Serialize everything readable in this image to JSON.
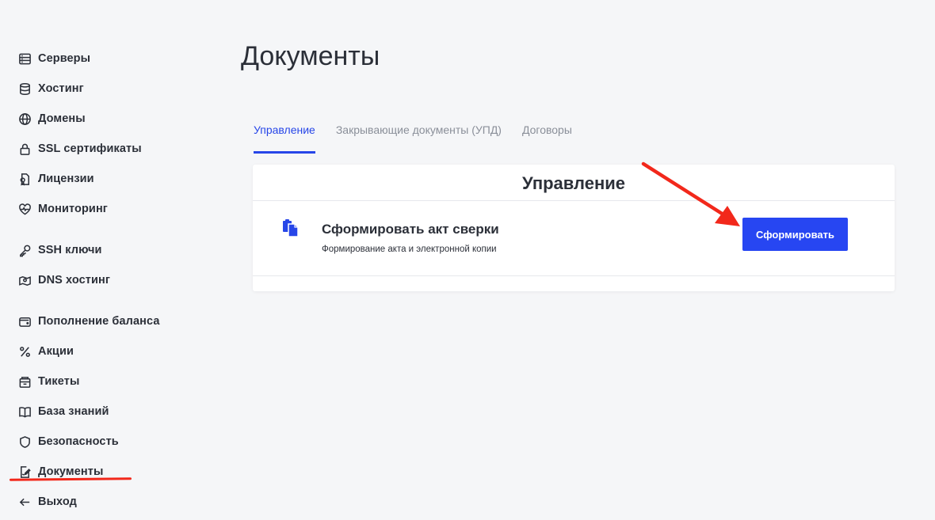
{
  "sidebar": {
    "items": [
      {
        "label": "Серверы",
        "icon": "server-icon"
      },
      {
        "label": "Хостинг",
        "icon": "database-icon"
      },
      {
        "label": "Домены",
        "icon": "globe-icon"
      },
      {
        "label": "SSL сертификаты",
        "icon": "lock-icon"
      },
      {
        "label": "Лицензии",
        "icon": "license-icon"
      },
      {
        "label": "Мониторинг",
        "icon": "heartbeat-icon"
      },
      {
        "label": "SSH ключи",
        "icon": "key-icon"
      },
      {
        "label": "DNS хостинг",
        "icon": "dns-map-icon"
      },
      {
        "label": "Пополнение баланса",
        "icon": "wallet-icon"
      },
      {
        "label": "Акции",
        "icon": "percent-icon"
      },
      {
        "label": "Тикеты",
        "icon": "ticket-icon"
      },
      {
        "label": "База знаний",
        "icon": "book-icon"
      },
      {
        "label": "Безопасность",
        "icon": "shield-icon"
      },
      {
        "label": "Документы",
        "icon": "document-edit-icon"
      },
      {
        "label": "Выход",
        "icon": "arrow-left-icon"
      }
    ]
  },
  "main": {
    "title": "Документы",
    "tabs": [
      {
        "label": "Управление",
        "active": true
      },
      {
        "label": "Закрывающие документы (УПД)",
        "active": false
      },
      {
        "label": "Договоры",
        "active": false
      }
    ],
    "card": {
      "header": "Управление",
      "row": {
        "icon": "clipboard-copy-icon",
        "title": "Сформировать акт сверки",
        "description": "Формирование акта и электронной копии",
        "button_label": "Сформировать"
      }
    }
  },
  "colors": {
    "accent": "#2746f2",
    "annotation_red": "#f2281b",
    "background": "#f5f6f8"
  }
}
